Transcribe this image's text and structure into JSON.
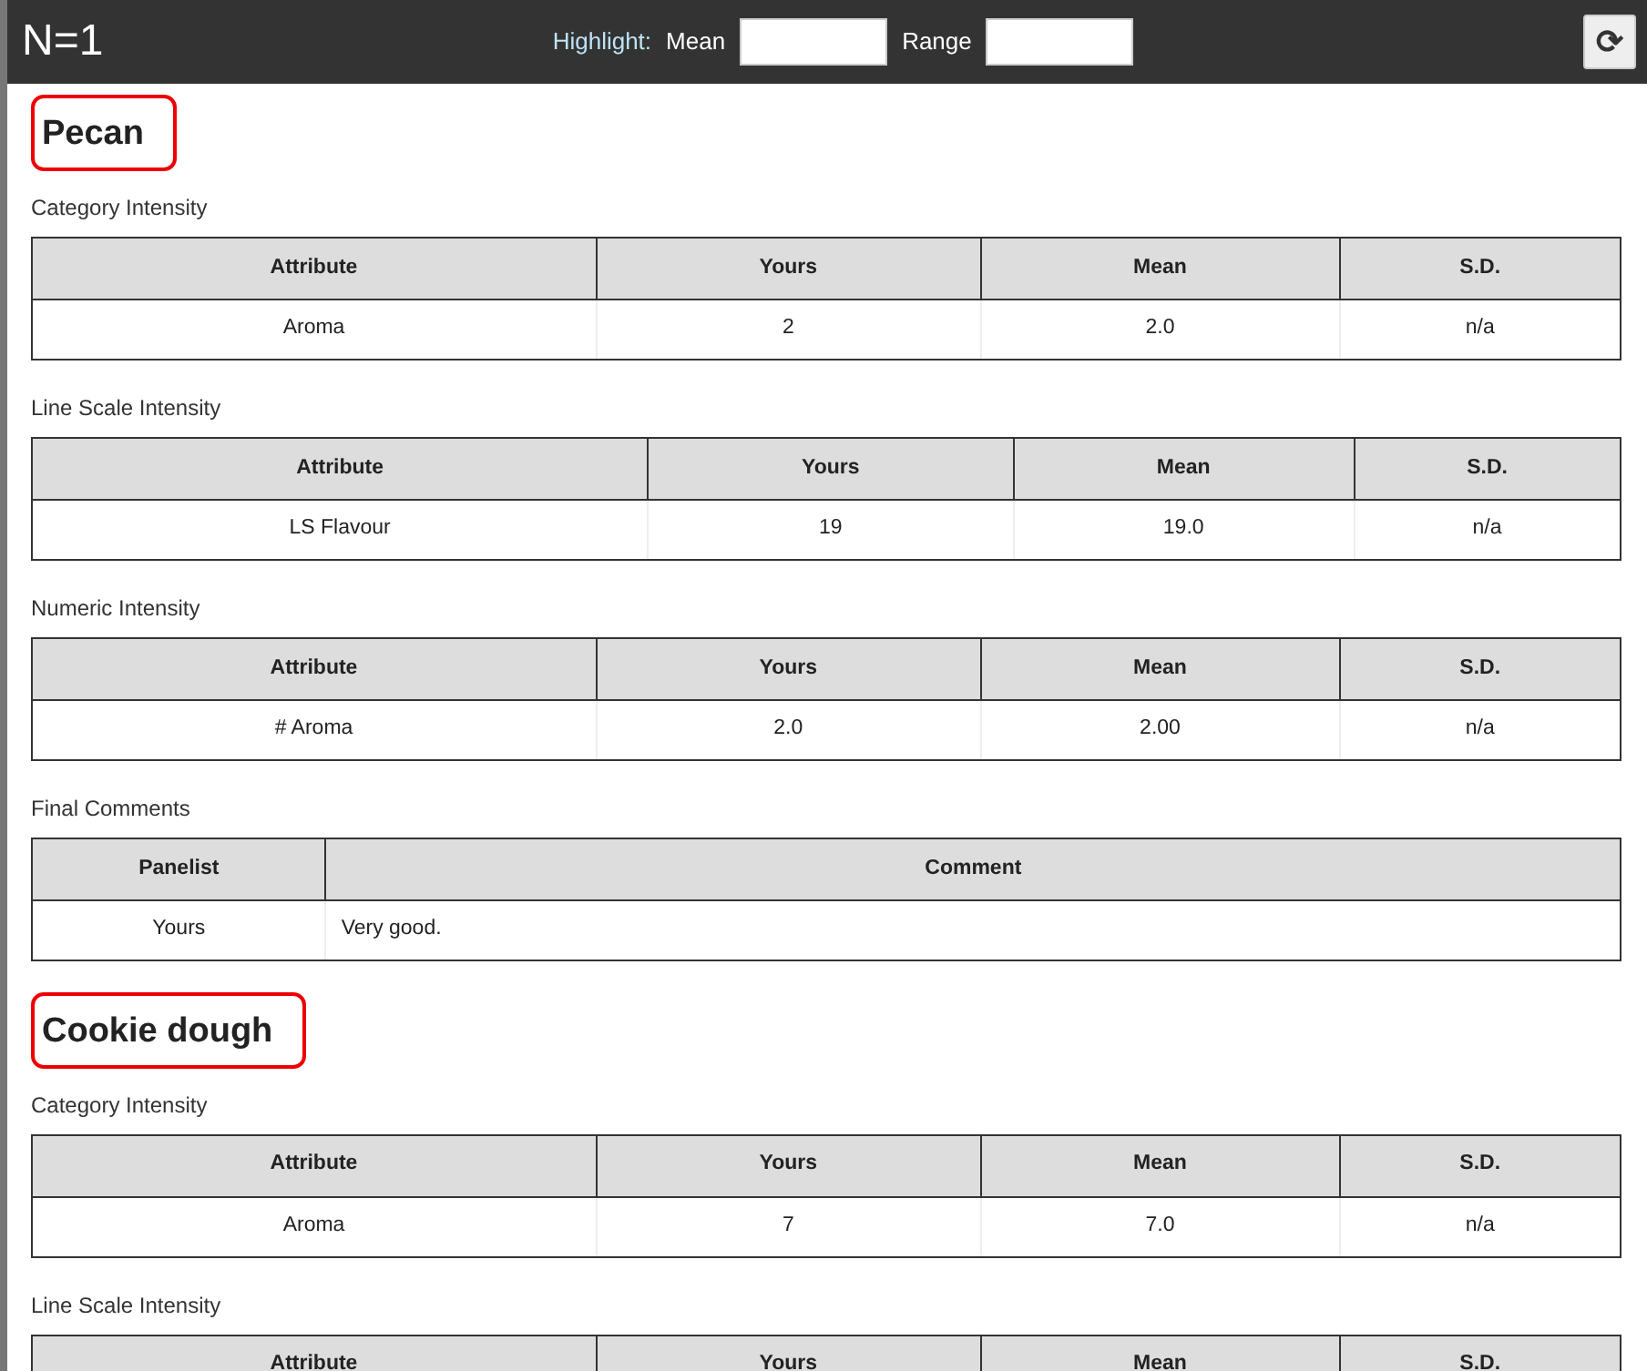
{
  "header": {
    "title": "N=1",
    "highlight_label": "Highlight:",
    "mean_label": "Mean",
    "range_label": "Range",
    "refresh": "⟳"
  },
  "products": [
    {
      "name": "Pecan",
      "annotated": true,
      "blocks": [
        {
          "caption": "Category Intensity",
          "columns": [
            "Attribute",
            "Yours",
            "Mean",
            "S.D."
          ],
          "rows": [
            [
              "Aroma",
              "2",
              "2.0",
              "n/a"
            ]
          ]
        },
        {
          "caption": "Line Scale Intensity",
          "columns": [
            "Attribute",
            "Yours",
            "Mean",
            "S.D."
          ],
          "rows": [
            [
              "LS Flavour",
              "19",
              "19.0",
              "n/a"
            ]
          ]
        },
        {
          "caption": "Numeric Intensity",
          "columns": [
            "Attribute",
            "Yours",
            "Mean",
            "S.D."
          ],
          "rows": [
            [
              "# Aroma",
              "2.0",
              "2.00",
              "n/a"
            ]
          ]
        },
        {
          "caption": "Final Comments",
          "kind": "comments",
          "columns": [
            "Panelist",
            "Comment"
          ],
          "rows": [
            [
              "Yours",
              "Very good."
            ]
          ]
        }
      ]
    },
    {
      "name": "Cookie dough",
      "annotated": true,
      "blocks": [
        {
          "caption": "Category Intensity",
          "columns": [
            "Attribute",
            "Yours",
            "Mean",
            "S.D."
          ],
          "rows": [
            [
              "Aroma",
              "7",
              "7.0",
              "n/a"
            ]
          ]
        },
        {
          "caption": "Line Scale Intensity",
          "columns": [
            "Attribute",
            "Yours",
            "Mean",
            "S.D."
          ]
        }
      ]
    }
  ]
}
